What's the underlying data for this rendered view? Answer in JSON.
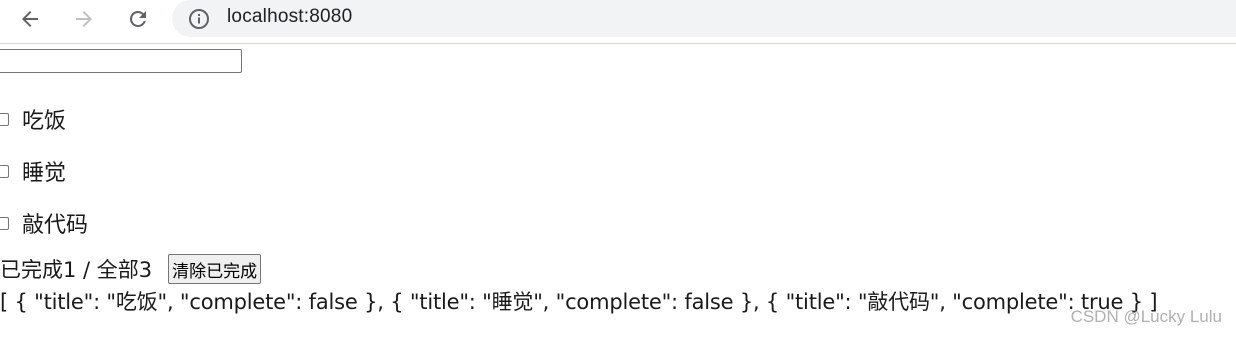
{
  "browser": {
    "url": "localhost:8080",
    "icons": [
      "back-arrow-icon",
      "forward-arrow-icon",
      "reload-icon",
      "info-icon"
    ]
  },
  "input": {
    "value": "",
    "placeholder": ""
  },
  "todos": [
    {
      "label": "吃饭",
      "checked": false
    },
    {
      "label": "睡觉",
      "checked": false
    },
    {
      "label": "敲代码",
      "checked": false
    }
  ],
  "footer": {
    "summary": "已完成1 / 全部3",
    "clear_label": "清除已完成"
  },
  "json_output": "[ { \"title\": \"吃饭\", \"complete\": false }, { \"title\": \"睡觉\", \"complete\": false }, { \"title\": \"敲代码\", \"complete\": true } ]",
  "watermark": "CSDN @Lucky Lulu"
}
